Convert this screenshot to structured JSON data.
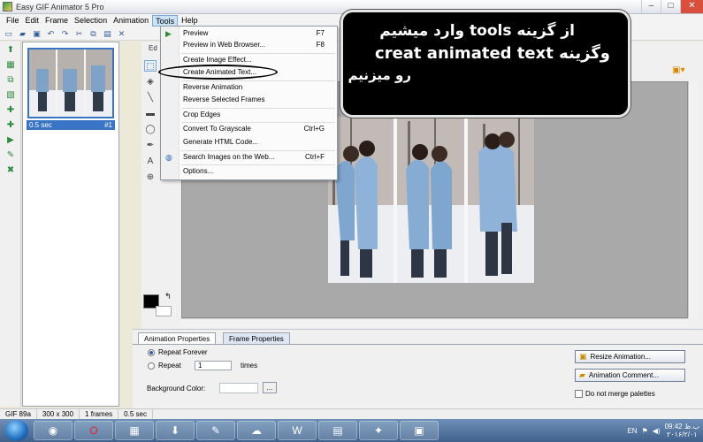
{
  "window": {
    "title": "Easy GIF Animator 5 Pro",
    "controls": [
      "–",
      "□",
      "✕"
    ]
  },
  "menu": [
    "File",
    "Edit",
    "Frame",
    "Selection",
    "Animation",
    "Tools",
    "Help"
  ],
  "menu_active": "Tools",
  "tools_menu": {
    "items": [
      {
        "label": "Preview",
        "shortcut": "F7",
        "icon": "play-icon"
      },
      {
        "label": "Preview in Web Browser...",
        "shortcut": "F8",
        "icon": ""
      },
      {
        "label": "Create Image Effect...",
        "shortcut": "",
        "icon": ""
      },
      {
        "label": "Create Animated Text...",
        "shortcut": "",
        "icon": ""
      },
      {
        "label": "Reverse Animation",
        "shortcut": "",
        "icon": ""
      },
      {
        "label": "Reverse Selected Frames",
        "shortcut": "",
        "icon": ""
      },
      {
        "label": "Crop Edges",
        "shortcut": "",
        "icon": ""
      },
      {
        "label": "Convert To Grayscale",
        "shortcut": "Ctrl+G",
        "icon": ""
      },
      {
        "label": "Generate HTML Code...",
        "shortcut": "",
        "icon": ""
      },
      {
        "label": "Search Images on the Web...",
        "shortcut": "Ctrl+F",
        "icon": "globe-icon"
      },
      {
        "label": "Options...",
        "shortcut": "",
        "icon": ""
      }
    ]
  },
  "frame_panel": {
    "frame_delay": "0.5 sec",
    "frame_number": "#1"
  },
  "edit_tab": "Ed",
  "properties": {
    "tabs": [
      "Animation Properties",
      "Frame Properties"
    ],
    "repeat_forever": "Repeat Forever",
    "repeat": "Repeat",
    "repeat_count": "1",
    "times": "times",
    "background_color": "Background Color:",
    "dots": "...",
    "resize_button": "Resize Animation...",
    "comment_button": "Animation Comment...",
    "dont_merge": "Do not merge palettes"
  },
  "status": [
    "GIF 89a",
    "300 x 300",
    "1 frames",
    "0.5 sec"
  ],
  "callout": {
    "line1": "از گزینه tools وارد میشیم",
    "line2": "creat animated text وگزینه",
    "line3": "رو میزنیم"
  },
  "taskbar": {
    "lang": "EN",
    "time": "09:42 ب.ظ",
    "date": "۲۰۱۶/۲/۰۱"
  }
}
